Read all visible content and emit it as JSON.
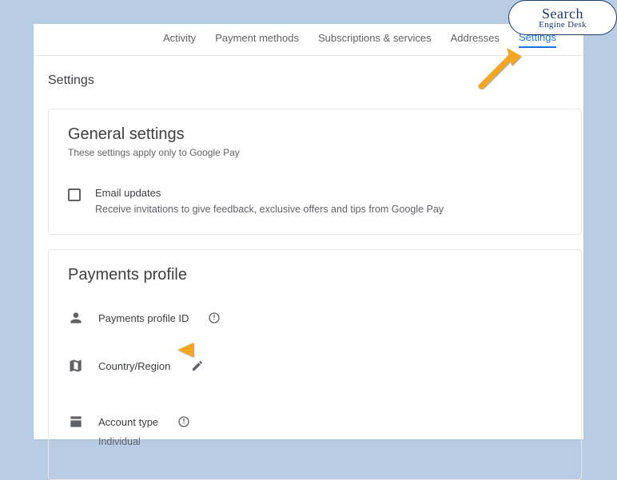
{
  "tabs": {
    "activity": "Activity",
    "payment_methods": "Payment methods",
    "subscriptions": "Subscriptions & services",
    "addresses": "Addresses",
    "settings": "Settings"
  },
  "page_title": "Settings",
  "general": {
    "title": "General settings",
    "subtitle": "These settings apply only to Google Pay",
    "email_label": "Email updates",
    "email_desc": "Receive invitations to give feedback, exclusive offers and tips from Google Pay"
  },
  "profile": {
    "title": "Payments profile",
    "profile_id_label": "Payments profile ID",
    "country_label": "Country/Region",
    "account_type_label": "Account type",
    "account_type_value": "Individual"
  },
  "badge": {
    "top": "Search",
    "bottom": "Engine Desk"
  }
}
